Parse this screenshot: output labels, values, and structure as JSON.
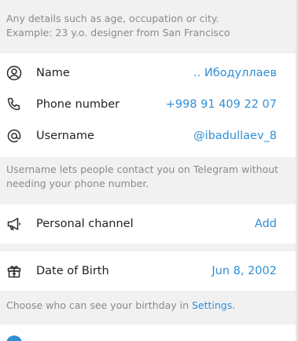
{
  "bio_hint": {
    "line1": "Any details such as age, occupation or city.",
    "line2": "Example: 23 y.o. designer from San Francisco"
  },
  "info": {
    "name": {
      "icon": "person-icon",
      "label": "Name",
      "value": ".. Ибодуллаев"
    },
    "phone": {
      "icon": "phone-icon",
      "label": "Phone number",
      "value": "+998 91 409 22 07"
    },
    "username": {
      "icon": "at-sign-icon",
      "label": "Username",
      "value": "@ibadullaev_8"
    }
  },
  "username_hint": {
    "line1": "Username lets people contact you on Telegram without",
    "line2": "needing your phone number."
  },
  "channel": {
    "icon": "megaphone-icon",
    "label": "Personal channel",
    "value": "Add"
  },
  "birthday": {
    "icon": "gift-icon",
    "label": "Date of Birth",
    "value": "Jun 8, 2002"
  },
  "birthday_hint": {
    "text": "Choose who can see your birthday in ",
    "link": "Settings",
    "suffix": "."
  },
  "colors": {
    "accent": "#2f8fd5",
    "background": "#f1f1f1",
    "card": "#ffffff",
    "hint": "#8a8a8a"
  }
}
